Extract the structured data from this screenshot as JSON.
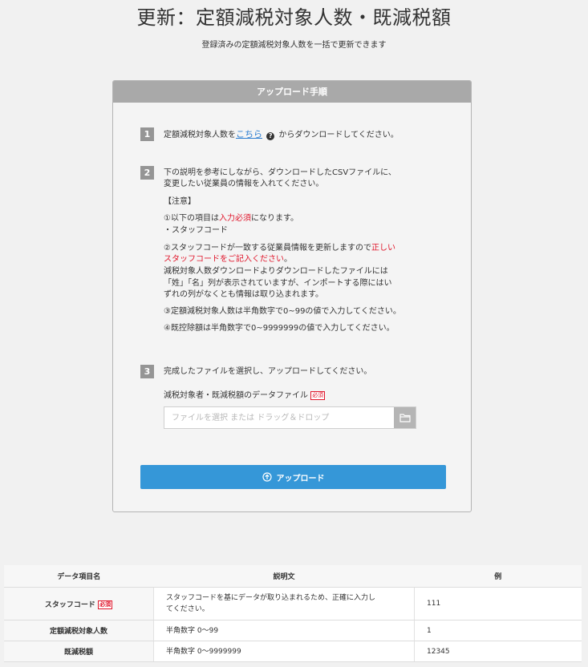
{
  "page": {
    "title": "更新：定額減税対象人数・既減税額",
    "subtitle": "登録済みの定額減税対象人数を一括で更新できます"
  },
  "card": {
    "header": "アップロード手順",
    "step1": {
      "num": "1",
      "before": "定額減税対象人数を",
      "link": "こちら",
      "after": "からダウンロードしてください。"
    },
    "step2": {
      "num": "2",
      "line1": "下の説明を参考にしながら、ダウンロードしたCSVファイルに、",
      "line2": "変更したい従業員の情報を入れてください。",
      "note_title": "【注意】",
      "n1_before": "①以下の項目は",
      "n1_red": "入力必須",
      "n1_after": "になります。",
      "n1_item": "・スタッフコード",
      "n2_before": "②スタッフコードが一致する従業員情報を更新しますので",
      "n2_red1": "正しい",
      "n2_red2": "スタッフコードをご記入ください",
      "n2_end": "。",
      "n2_l3": "減税対象人数ダウンロードよりダウンロードしたファイルには",
      "n2_l4": "「姓」「名」列が表示されていますが、インポートする際にはい",
      "n2_l5": "ずれの列がなくとも情報は取り込まれます。",
      "n3": "③定額減税対象人数は半角数字で0~99の値で入力してください。",
      "n4": "④既控除額は半角数字で0~9999999の値で入力してください。"
    },
    "step3": {
      "num": "3",
      "text": "完成したファイルを選択し、アップロードしてください。",
      "field_label": "減税対象者・既減税額のデータファイル",
      "required": "必須",
      "placeholder": "ファイルを選択 または ドラッグ＆ドロップ"
    },
    "upload_button": "アップロード"
  },
  "table": {
    "headers": [
      "データ項目名",
      "説明文",
      "例"
    ],
    "rows": [
      {
        "name": "スタッフコード",
        "required": "必須",
        "desc_l1": "スタッフコードを基にデータが取り込まれるため、正確に入力し",
        "desc_l2": "てください。",
        "example": "111"
      },
      {
        "name": "定額減税対象人数",
        "desc": "半角数字 0〜99",
        "example": "1"
      },
      {
        "name": "既減税額",
        "desc": "半角数字 0〜9999999",
        "example": "12345"
      }
    ]
  },
  "colors": {
    "accent": "#3597d8",
    "required": "#e0162b",
    "link": "#2f7fd1",
    "card_header": "#a9a9a9"
  }
}
